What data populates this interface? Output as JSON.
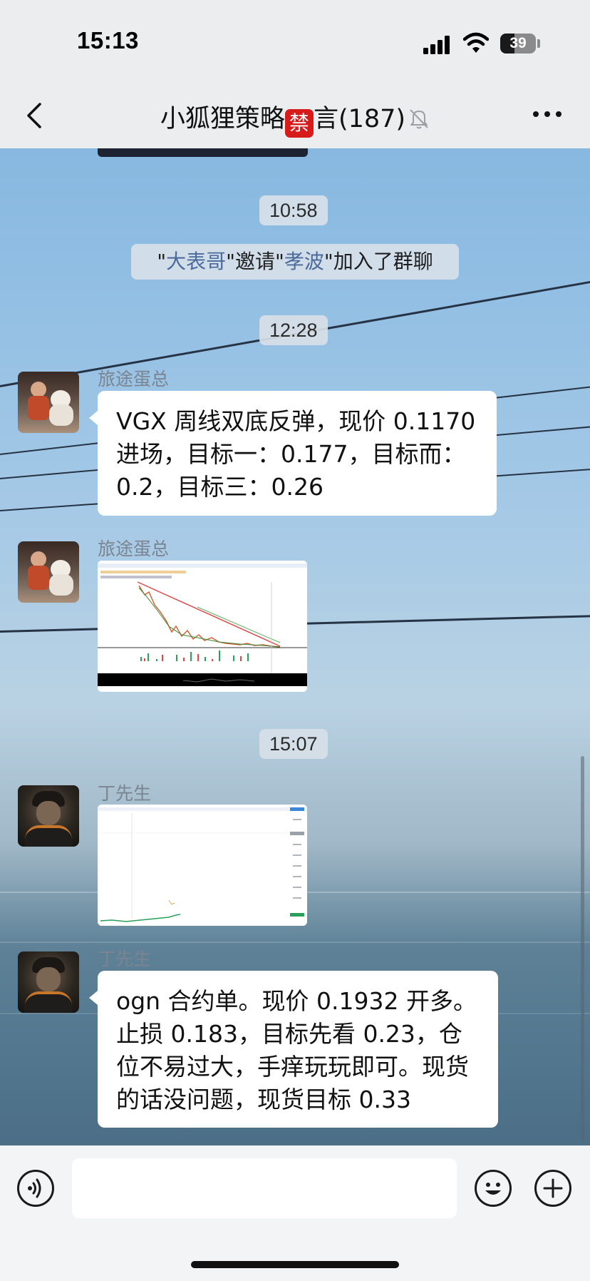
{
  "status_bar": {
    "time": "15:13",
    "battery": "39",
    "battery_level_percent": 39
  },
  "header": {
    "title": "小狐狸策略",
    "ban_char": "禁",
    "title_suffix": "言(187)"
  },
  "messages": {
    "ts1": "10:58",
    "system": {
      "q1": "\"",
      "inviter": "大表哥",
      "q2": "\"邀请\"",
      "invitee": "孝波",
      "q3": "\"加入了群聊"
    },
    "ts2": "12:28",
    "m1": {
      "sender": "旅途蛋总",
      "text": "VGX 周线双底反弹，现价 0.1170 进场，目标一：0.177，目标而：0.2，目标三：0.26"
    },
    "m2": {
      "sender": "旅途蛋总"
    },
    "ts3": "15:07",
    "m3": {
      "sender": "丁先生"
    },
    "m4": {
      "sender": "丁先生",
      "text": "ogn 合约单。现价 0.1932 开多。止损 0.183，目标先看 0.23，仓位不易过大，手痒玩玩即可。现货的话没问题，现货目标 0.33"
    }
  },
  "input": {
    "value": ""
  },
  "colors": {
    "accent_red": "#d71a1a",
    "link_blue": "#4a6b9b"
  }
}
